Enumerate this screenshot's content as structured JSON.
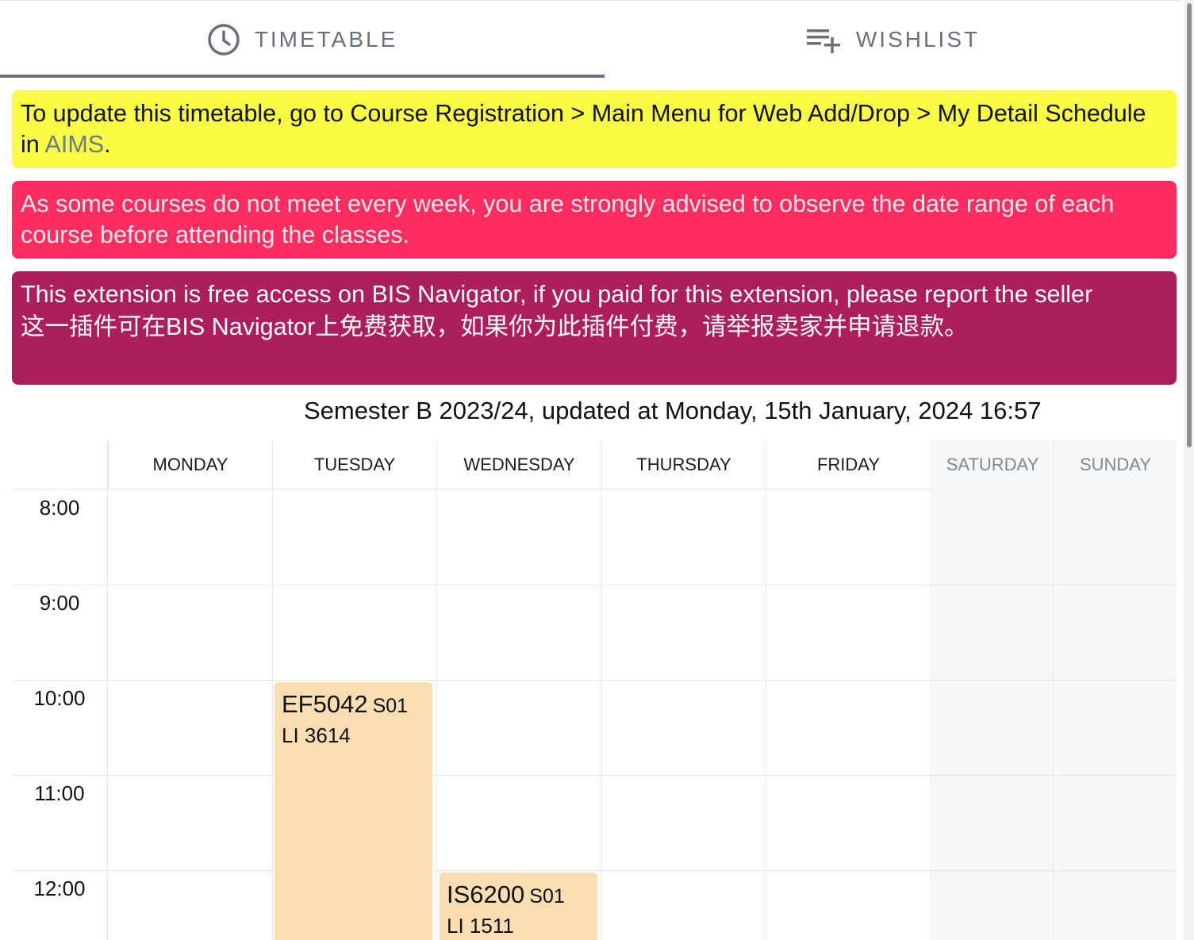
{
  "tabs": [
    {
      "label": "TIMETABLE",
      "icon": "clock-icon",
      "active": true
    },
    {
      "label": "WISHLIST",
      "icon": "playlist-add-icon",
      "active": false
    }
  ],
  "notices": {
    "yellow": {
      "text_before": "To update this timetable, go to Course Registration > Main Menu for Web Add/Drop > My Detail Schedule in ",
      "link": "AIMS",
      "text_after": "."
    },
    "red": "As some courses do not meet every week, you are strongly advised to observe the date range of each course before attending the classes.",
    "purple": {
      "en": "This extension is free access on BIS Navigator, if you paid for this extension, please report the seller",
      "zh": "这一插件可在BIS Navigator上免费获取，如果你为此插件付费，请举报卖家并申请退款。"
    }
  },
  "semester_line": "Semester B 2023/24, updated at Monday, 15th January, 2024 16:57",
  "calendar": {
    "days": [
      "MONDAY",
      "TUESDAY",
      "WEDNESDAY",
      "THURSDAY",
      "FRIDAY",
      "SATURDAY",
      "SUNDAY"
    ],
    "times": [
      "8:00",
      "9:00",
      "10:00",
      "11:00",
      "12:00"
    ],
    "events": [
      {
        "code": "EF5042",
        "section": "S01",
        "venue": "LI 3614",
        "day": "TUESDAY",
        "start": "10:00"
      },
      {
        "code": "IS6200",
        "section": "S01",
        "venue": "LI 1511",
        "day": "WEDNESDAY",
        "start": "12:00"
      }
    ]
  },
  "colors": {
    "yellow_notice": "#f9fb45",
    "red_notice": "#ff2d5f",
    "purple_notice": "#ad1f5c",
    "event_bg": "#f9ddb3",
    "tab_text": "#6b6f78"
  }
}
